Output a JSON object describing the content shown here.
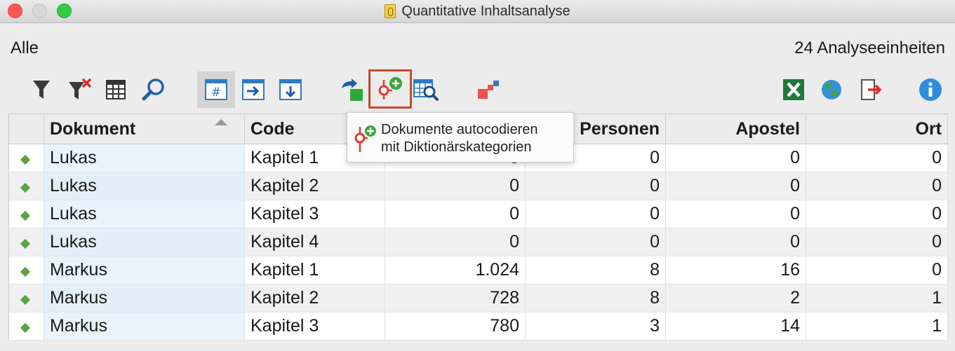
{
  "window": {
    "title": "Quantitative Inhaltsanalyse"
  },
  "header": {
    "scope_label": "Alle",
    "units_count": "24 Analyseeinheiten"
  },
  "toolbar": {
    "icons": [
      "filter-icon",
      "clear-filter-icon",
      "columns-icon",
      "search-icon",
      "count-table-icon",
      "export-right-icon",
      "export-down-icon",
      "transform-icon",
      "autocode-dictionary-icon",
      "table-search-icon",
      "mds-icon",
      "excel-icon",
      "web-export-icon",
      "export-icon",
      "info-icon"
    ],
    "colors": {
      "accent_red": "#c84a30",
      "excel_green": "#1e7a3c",
      "info_blue": "#2f8be0"
    }
  },
  "tooltip": {
    "line1": "Dokumente autocodieren",
    "line2": "mit Diktionärskategorien"
  },
  "table": {
    "columns": [
      "Dokument",
      "Code",
      "",
      "Personen",
      "Apostel",
      "Ort"
    ],
    "rows": [
      {
        "doc": "Lukas",
        "code": "Kapitel 1",
        "c3": "0",
        "personen": "0",
        "apostel": "0",
        "ort": "0"
      },
      {
        "doc": "Lukas",
        "code": "Kapitel 2",
        "c3": "0",
        "personen": "0",
        "apostel": "0",
        "ort": "0"
      },
      {
        "doc": "Lukas",
        "code": "Kapitel 3",
        "c3": "0",
        "personen": "0",
        "apostel": "0",
        "ort": "0"
      },
      {
        "doc": "Lukas",
        "code": "Kapitel 4",
        "c3": "0",
        "personen": "0",
        "apostel": "0",
        "ort": "0"
      },
      {
        "doc": "Markus",
        "code": "Kapitel 1",
        "c3": "1.024",
        "personen": "8",
        "apostel": "16",
        "ort": "0"
      },
      {
        "doc": "Markus",
        "code": "Kapitel 2",
        "c3": "728",
        "personen": "8",
        "apostel": "2",
        "ort": "1"
      },
      {
        "doc": "Markus",
        "code": "Kapitel 3",
        "c3": "780",
        "personen": "3",
        "apostel": "14",
        "ort": "1"
      }
    ]
  }
}
